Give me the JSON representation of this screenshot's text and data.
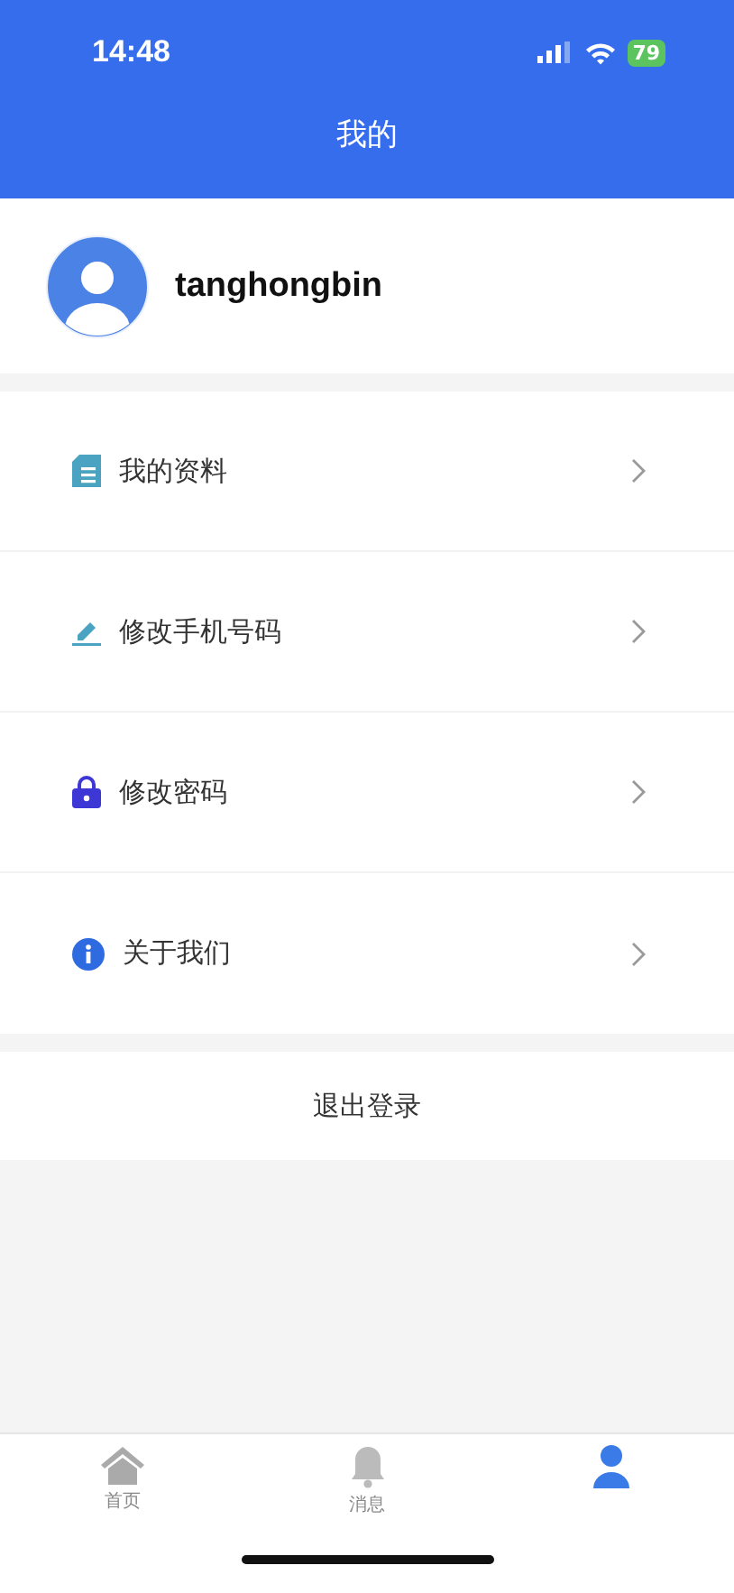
{
  "status_bar": {
    "time": "14:48",
    "battery": "79"
  },
  "header": {
    "title": "我的"
  },
  "profile": {
    "username": "tanghongbin"
  },
  "menu": [
    {
      "kind": "doc",
      "label": "我的资料"
    },
    {
      "kind": "pen",
      "label": "修改手机号码"
    },
    {
      "kind": "lock",
      "label": "修改密码"
    },
    {
      "kind": "info",
      "label": "关于我们"
    }
  ],
  "logout": "退出登录",
  "tabs": [
    {
      "kind": "home",
      "label": "首页",
      "selected": false
    },
    {
      "kind": "bell",
      "label": "消息",
      "selected": false
    },
    {
      "kind": "person",
      "selected": true
    }
  ]
}
